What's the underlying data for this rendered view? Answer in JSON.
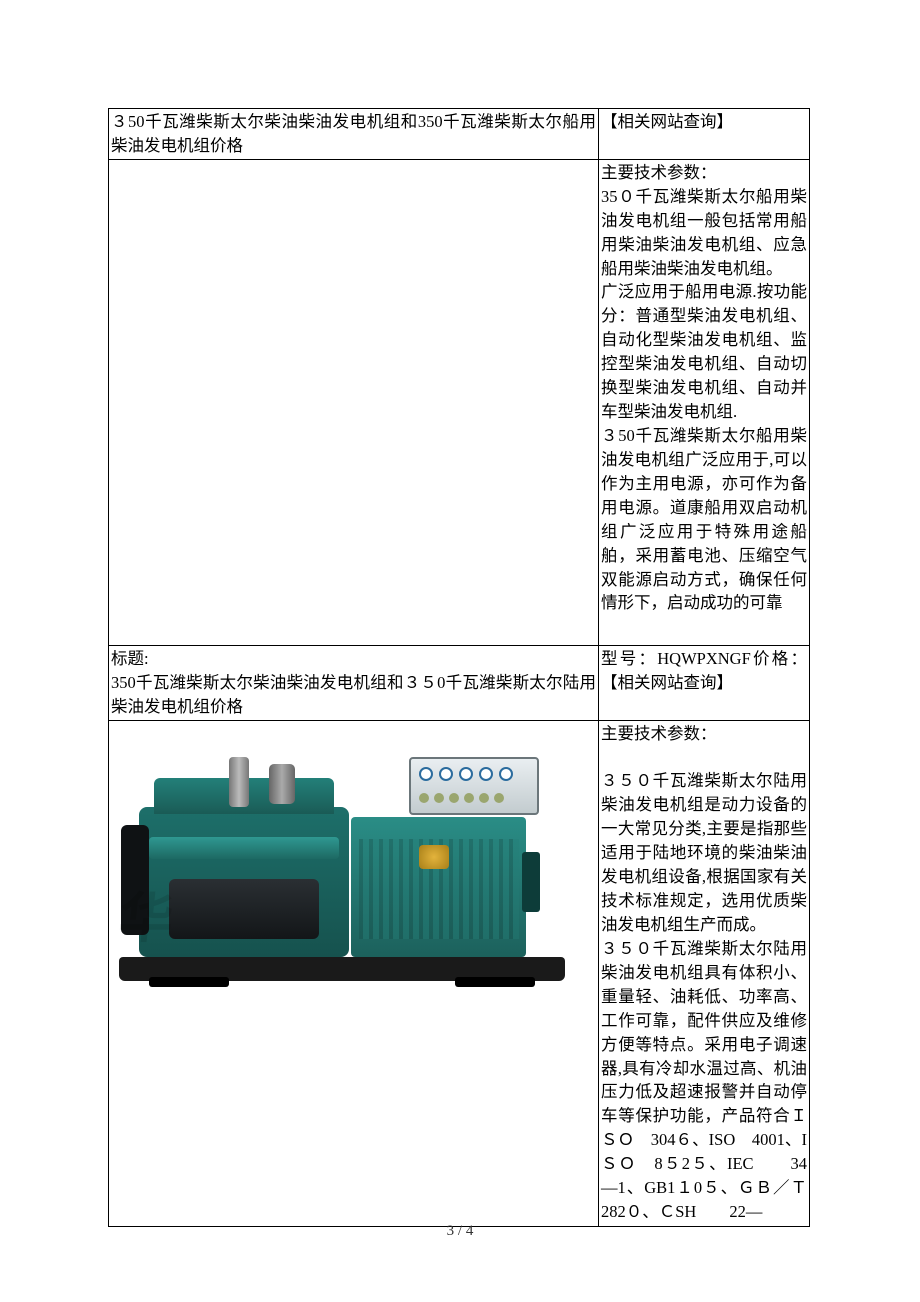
{
  "rows": {
    "r1_left": "３50千瓦潍柴斯太尔柴油柴油发电机组和350千瓦潍柴斯太尔船用柴油发电机组价格",
    "r1_right": "【相关网站查询】",
    "r2_right": "主要技术参数：\n35０千瓦潍柴斯太尔船用柴油发电机组一般包括常用船用柴油柴油发电机组、应急船用柴油柴油发电机组。\n广泛应用于船用电源.按功能分：普通型柴油发电机组、自动化型柴油发电机组、监控型柴油发电机组、自动切换型柴油发电机组、自动并车型柴油发电机组.\n３50千瓦潍柴斯太尔船用柴油发电机组广泛应用于,可以作为主用电源，亦可作为备用电源。道康船用双启动机组广泛应用于特殊用途船舶，采用蓄电池、压缩空气双能源启动方式，确保任何情形下，启动成功的可靠",
    "r3_left": "标题:\n350千瓦潍柴斯太尔柴油柴油发电机组和３５0千瓦潍柴斯太尔陆用柴油发电机组价格",
    "r3_right": "型号：HQWPXNGF价格：【相关网站查询】",
    "r4_right": "主要技术参数：\n\n３５０千瓦潍柴斯太尔陆用柴油发电机组是动力设备的一大常见分类,主要是指那些适用于陆地环境的柴油柴油发电机组设备,根据国家有关技术标准规定，选用优质柴油发电机组生产而成。\n３５０千瓦潍柴斯太尔陆用柴油发电机组具有体积小、重量轻、油耗低、功率高、工作可靠，配件供应及维修方便等特点。采用电子调速器,具有冷却水温过高、机油压力低及超速报警并自动停车等保护功能，产品符合ＩＳＯ　304６、ISO　4001、IＳＯ　8５2５、IEC　　34—1、GB1１0５、ＧＢ／Ｔ　282０、ＣSH　　22—"
  },
  "footer": "3 / 4"
}
